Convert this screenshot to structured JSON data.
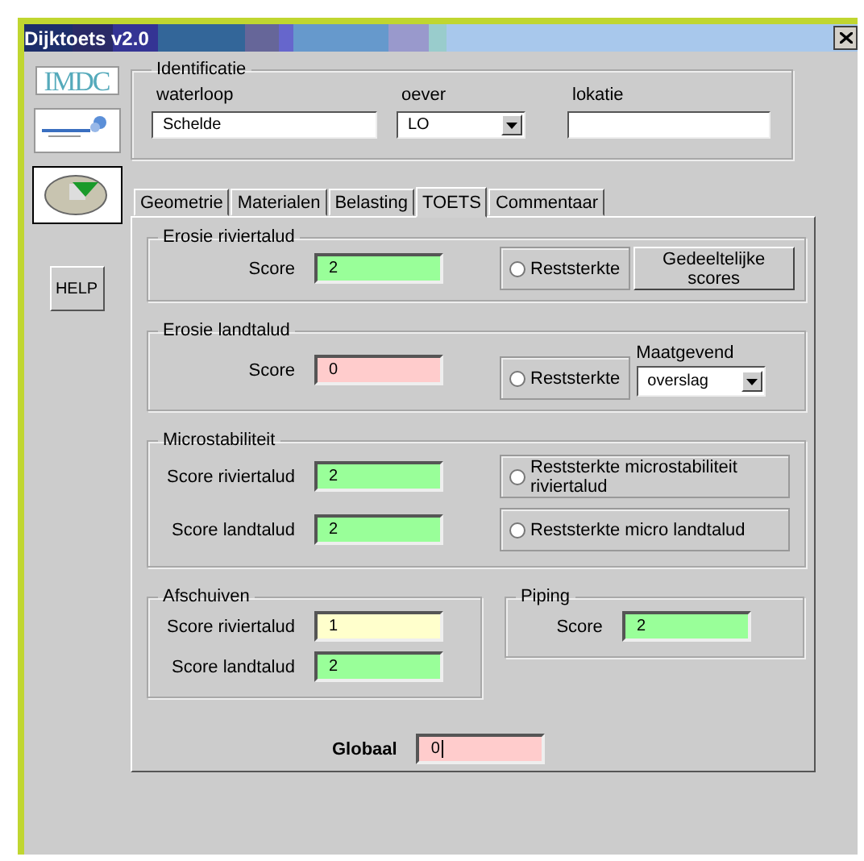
{
  "window": {
    "title": "Dijktoets v2.0"
  },
  "sidebar": {
    "logo": "IMDC",
    "help_button": "HELP"
  },
  "identificatie": {
    "title": "Identificatie",
    "fields": [
      {
        "kind": "text",
        "label": "waterloop",
        "value": "Schelde"
      },
      {
        "kind": "dropdown",
        "label": "oever",
        "value": "LO"
      },
      {
        "kind": "text",
        "label": "lokatie"
      }
    ]
  },
  "tabs": [
    {
      "label": "Geometrie",
      "selected": false
    },
    {
      "label": "Materialen",
      "selected": false
    },
    {
      "label": "Belasting",
      "selected": false
    },
    {
      "label": "TOETS",
      "selected": true
    },
    {
      "label": "Commentaar",
      "selected": false
    }
  ],
  "erosie_riviertalud": {
    "title": "Erosie riviertalud",
    "score_label": "Score",
    "score": "2",
    "color": "#99ff99",
    "radio": {
      "label": "Reststerkte",
      "selected": false
    },
    "button": "Gedeeltelijke scores"
  },
  "erosie_landtalud": {
    "title": "Erosie landtalud",
    "score_label": "Score",
    "score": "0",
    "color": "#ffcccc",
    "radio": {
      "label": "Reststerkte",
      "selected": false
    },
    "maatgevend": {
      "label": "Maatgevend",
      "value": "overslag"
    }
  },
  "microstabiliteit": {
    "title": "Microstabiliteit",
    "rows": [
      {
        "label": "Score riviertalud",
        "score": "2",
        "color": "#99ff99",
        "radio": {
          "label": "Reststerkte microstabiliteit riviertalud",
          "selected": false
        }
      },
      {
        "label": "Score landtalud",
        "score": "2",
        "color": "#99ff99",
        "radio": {
          "label": "Reststerkte micro landtalud",
          "selected": false
        }
      }
    ]
  },
  "afschuiven": {
    "title": "Afschuiven",
    "rows": [
      {
        "label": "Score riviertalud",
        "score": "1",
        "color": "#ffffcc"
      },
      {
        "label": "Score landtalud",
        "score": "2",
        "color": "#99ff99"
      }
    ]
  },
  "piping": {
    "title": "Piping",
    "rows": [
      {
        "label": "Score",
        "score": "2",
        "color": "#99ff99"
      }
    ]
  },
  "globaal": {
    "label": "Globaal",
    "score": "0",
    "color": "#ffcccc"
  }
}
